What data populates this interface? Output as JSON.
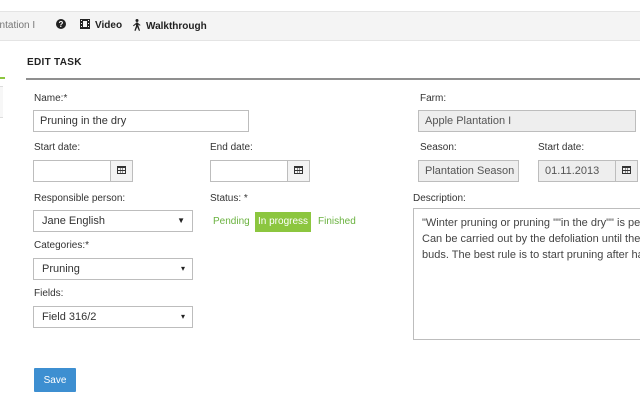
{
  "topbar": {
    "breadcrumb": "antation I",
    "video_label": "Video",
    "walkthrough_label": "Walkthrough"
  },
  "form": {
    "title": "EDIT TASK",
    "name": {
      "label": "Name:*",
      "value": "Pruning in the dry"
    },
    "start_date": {
      "label": "Start date:",
      "value": ""
    },
    "end_date": {
      "label": "End date:",
      "value": ""
    },
    "responsible": {
      "label": "Responsible person:",
      "value": "Jane English"
    },
    "status": {
      "label": "Status: *",
      "options": [
        "Pending",
        "In progress",
        "Finished"
      ],
      "selected": "In progress"
    },
    "categories": {
      "label": "Categories:*",
      "value": "Pruning"
    },
    "fields": {
      "label": "Fields:",
      "value": "Field 316/2"
    },
    "farm": {
      "label": "Farm:",
      "value": "Apple Plantation I"
    },
    "season": {
      "label": "Season:",
      "value": "Plantation Season"
    },
    "season_start": {
      "label": "Start date:",
      "value": "01.11.2013"
    },
    "description": {
      "label": "Description:",
      "lines": [
        "\"Winter pruning or pruning \"\"in the dry\"\" is perf",
        "Can be carried out by the defoliation until the",
        "buds. The best rule is to start pruning after ha"
      ]
    },
    "save_label": "Save"
  },
  "colors": {
    "accent_green": "#8cc63f",
    "status_text_green": "#6ab23f",
    "save_blue": "#3d8fd1"
  }
}
